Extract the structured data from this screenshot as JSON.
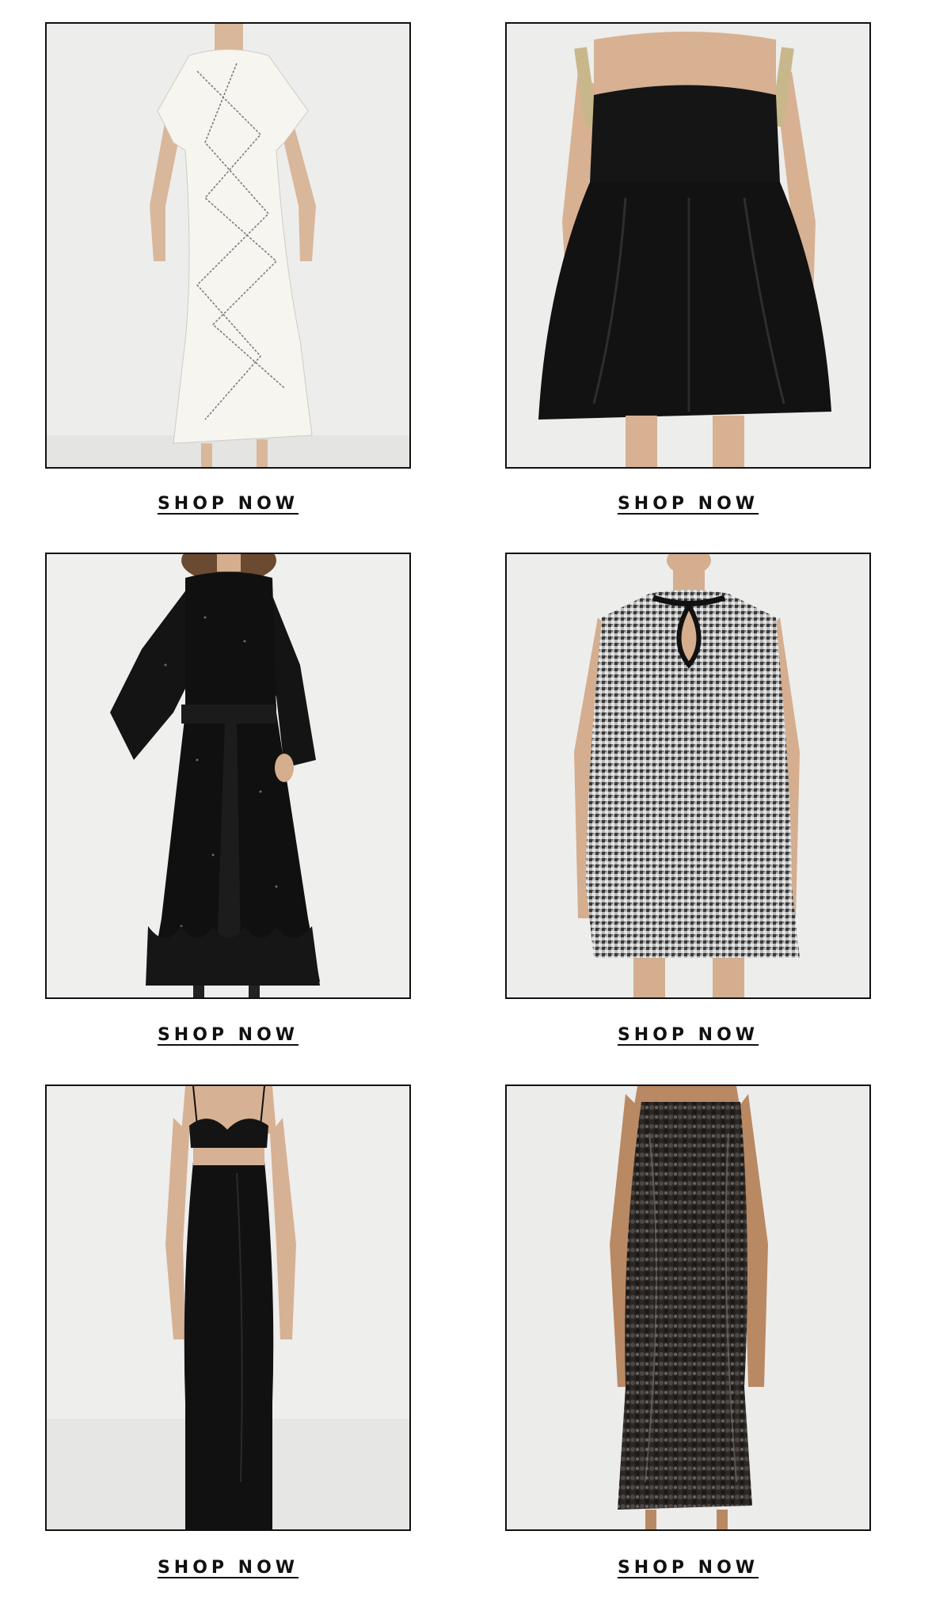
{
  "products": [
    {
      "cta": "SHOP NOW",
      "description": "white printed midi dress with flutter sleeves"
    },
    {
      "cta": "SHOP NOW",
      "description": "black satin mini dress with embellished straps"
    },
    {
      "cta": "SHOP NOW",
      "description": "black sparkle velvet long-sleeve midi dress with belt and ruffle hem"
    },
    {
      "cta": "SHOP NOW",
      "description": "black and white tweed sleeveless mini dress with keyhole"
    },
    {
      "cta": "SHOP NOW",
      "description": "black slip maxi dress with shell bust"
    },
    {
      "cta": "SHOP NOW",
      "description": "black sequin strapless midi dress"
    }
  ],
  "colors": {
    "border": "#111111",
    "background": "#ececec",
    "text": "#111111"
  }
}
